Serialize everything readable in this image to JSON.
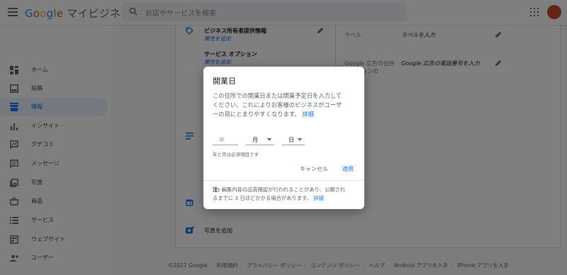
{
  "header": {
    "logo": {
      "g": "G",
      "o1": "o",
      "o2": "o",
      "g2": "g",
      "l": "l",
      "e": "e",
      "suffix": "マイビジネス"
    },
    "search_placeholder": "お店やサービスを検索"
  },
  "sidebar": {
    "items": [
      {
        "label": "ホーム",
        "icon": "dashboard-icon"
      },
      {
        "label": "投稿",
        "icon": "post-icon"
      },
      {
        "label": "情報",
        "icon": "storefront-icon",
        "active": true
      },
      {
        "label": "インサイト",
        "icon": "bar-chart-icon"
      },
      {
        "label": "クチコミ",
        "icon": "review-icon"
      },
      {
        "label": "メッセージ",
        "icon": "message-icon"
      },
      {
        "label": "写真",
        "icon": "photo-icon"
      },
      {
        "label": "商品",
        "icon": "basket-icon"
      },
      {
        "label": "サービス",
        "icon": "list-icon"
      },
      {
        "label": "ウェブサイト",
        "icon": "web-icon"
      },
      {
        "label": "ユーザー",
        "icon": "person-add-icon"
      }
    ]
  },
  "main": {
    "owner_info": {
      "title": "ビジネス所有者提供情報",
      "sub": "属性を追加"
    },
    "service_options": {
      "title": "サービス オプション",
      "sub": "属性を追加"
    },
    "label_row": {
      "label": "ラベル",
      "value": "ラベルを入力"
    },
    "ads_row": {
      "label1": "Google 広告の住所",
      "label2": "オプションの",
      "value": "Google 広告の電話番号を入力"
    },
    "add_photo": "写真を追加"
  },
  "footer": {
    "copyright": "©2021 Google",
    "links": [
      "利用規約",
      "プライバシー ポリシー",
      "コンテンツ ポリシー",
      "ヘルプ",
      "Android アプリを入手",
      "iPhone アプリを入手"
    ]
  },
  "dialog": {
    "title": "開業日",
    "body_line1": "この住所での開業日または開業予定日を入力して",
    "body_line2": "ください。これによりお客様のビジネスがユーザ",
    "body_line3": "ーの目にとまりやすくなります。",
    "body_link": "詳細",
    "year_placeholder": "年",
    "month_value": "月",
    "day_value": "日",
    "hint": "年と月は必須項目です",
    "cancel": "キャンセル",
    "apply": "適用",
    "note_label": "注:",
    "note_line1": "編集内容の品質確認が行われることがあり、公開され",
    "note_line2": "るまでに 3 日ほどかかる場合があります。",
    "note_link": "詳細"
  }
}
